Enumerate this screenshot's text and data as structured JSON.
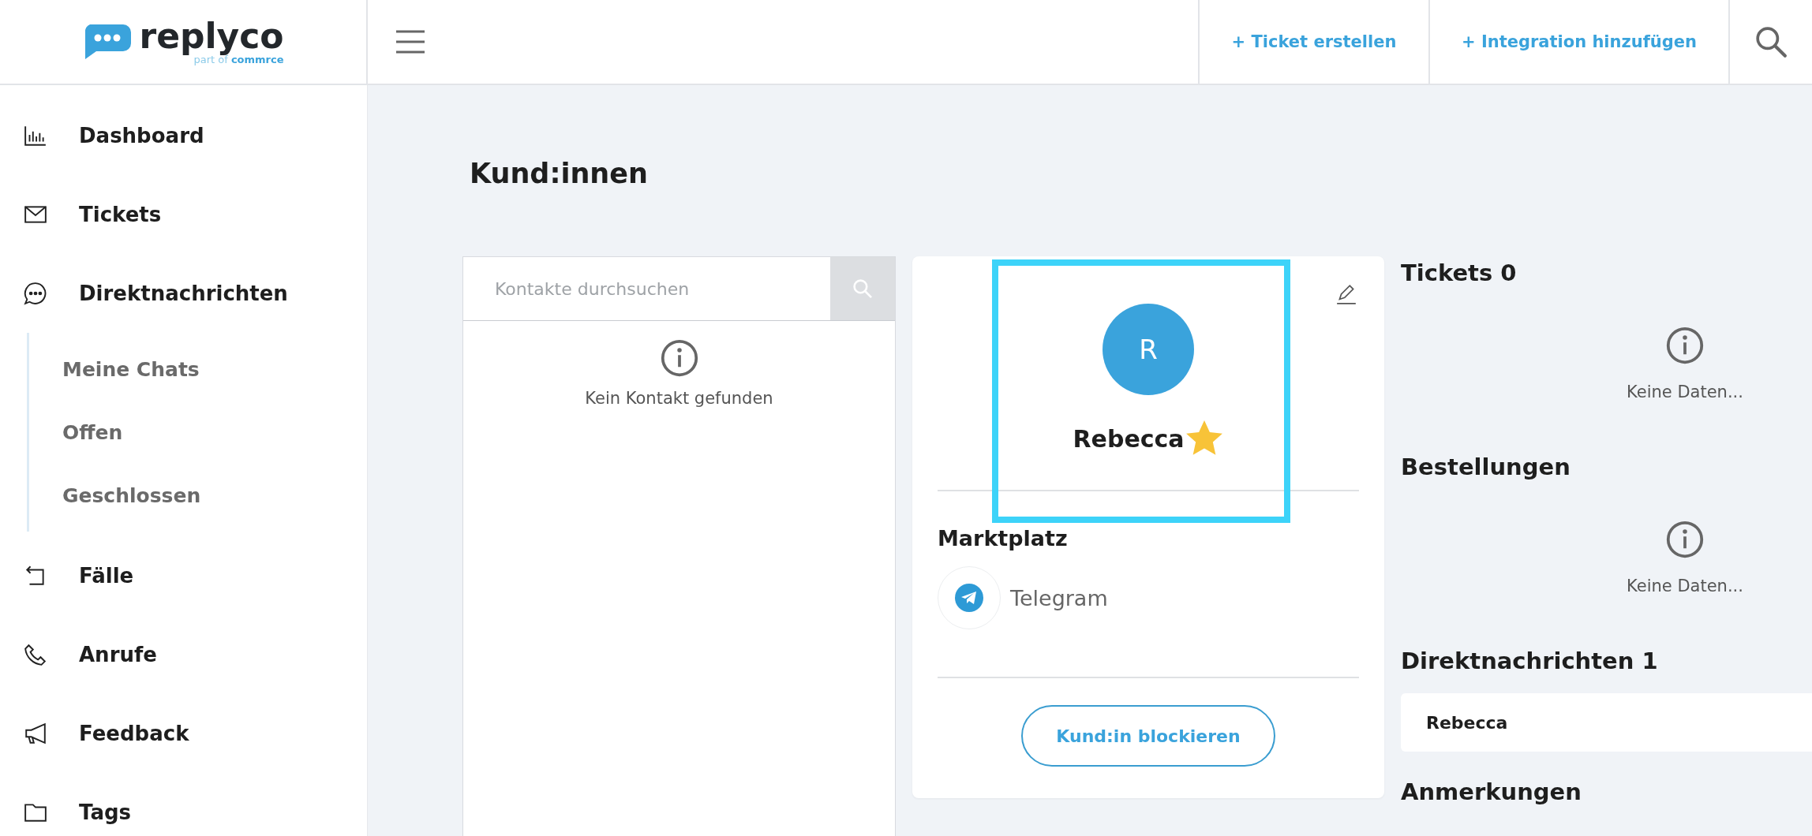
{
  "header": {
    "logo": {
      "name": "replyco",
      "tagline": "part of **commrce**"
    },
    "actions": [
      {
        "label": "+ Ticket erstellen"
      },
      {
        "label": "+ Integration hinzufügen"
      }
    ]
  },
  "sidebar": {
    "items": [
      {
        "label": "Dashboard",
        "kind": "chart"
      },
      {
        "label": "Tickets",
        "kind": "mail"
      },
      {
        "label": "Direktnachrichten",
        "kind": "chat",
        "expanded": true,
        "children": [
          {
            "label": "Meine Chats"
          },
          {
            "label": "Offen"
          },
          {
            "label": "Geschlossen"
          }
        ]
      },
      {
        "label": "Fälle",
        "kind": "return"
      },
      {
        "label": "Anrufe",
        "kind": "phone"
      },
      {
        "label": "Feedback",
        "kind": "megaphone"
      },
      {
        "label": "Tags",
        "kind": "folder"
      }
    ]
  },
  "page": {
    "title": "Kund:innen"
  },
  "contacts": {
    "search": {
      "placeholder": "Kontakte durchsuchen"
    },
    "empty_message": "Kein Kontakt gefunden"
  },
  "profile": {
    "initial": "R",
    "name": "Rebecca",
    "starred": true,
    "highlighted": true,
    "marketplace_heading": "Marktplatz",
    "marketplace": "Telegram",
    "block_button": "Kund:in blockieren"
  },
  "sections": [
    {
      "title": "Tickets 0",
      "kind": "empty",
      "message": "Keine Daten..."
    },
    {
      "title": "Bestellungen",
      "kind": "empty",
      "message": "Keine Daten..."
    },
    {
      "title": "Direktnachrichten 1",
      "kind": "list",
      "items": [
        "Rebecca"
      ]
    },
    {
      "title": "Anmerkungen",
      "kind": "heading"
    }
  ]
}
